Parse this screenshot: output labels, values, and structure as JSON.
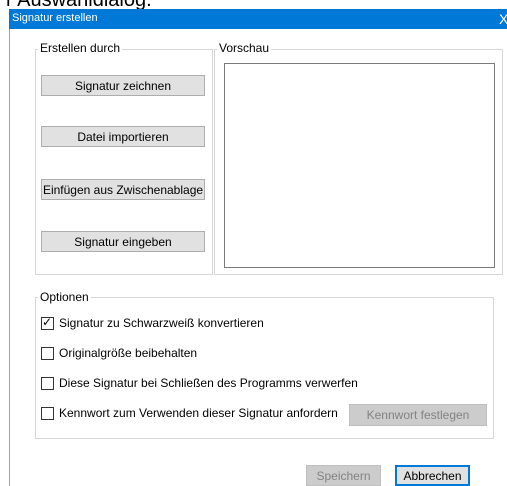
{
  "background_caption": "r Auswahldialog.",
  "window": {
    "title": "Signatur erstellen",
    "close_glyph": "X"
  },
  "create_group": {
    "label": "Erstellen durch",
    "buttons": {
      "draw": "Signatur zeichnen",
      "import": "Datei importieren",
      "paste": "Einfügen aus Zwischenablage",
      "type": "Signatur eingeben"
    }
  },
  "preview_group": {
    "label": "Vorschau"
  },
  "options_group": {
    "label": "Optionen",
    "items": [
      {
        "label": "Signatur zu Schwarzweiß konvertieren",
        "checked": true
      },
      {
        "label": "Originalgröße beibehalten",
        "checked": false
      },
      {
        "label": "Diese Signatur bei Schließen des Programms verwerfen",
        "checked": false
      },
      {
        "label": "Kennwort zum Verwenden dieser Signatur anfordern",
        "checked": false
      }
    ],
    "set_password_button": "Kennwort festlegen"
  },
  "footer": {
    "save_button": "Speichern",
    "cancel_button": "Abbrechen"
  },
  "colors": {
    "titlebar": "#0078d7",
    "button_face": "#e1e1e1",
    "disabled_text": "#838383",
    "group_border": "#d6d6d6"
  }
}
